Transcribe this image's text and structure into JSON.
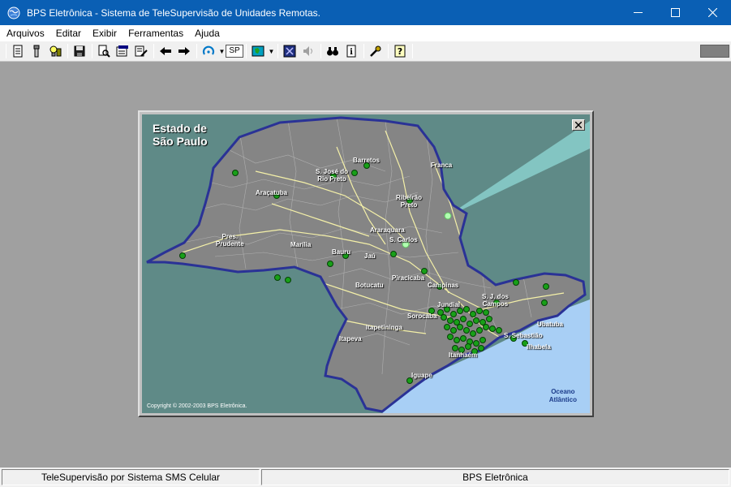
{
  "window": {
    "title": "BPS Eletrônica - Sistema de TeleSupervisão de Unidades Remotas."
  },
  "menu": [
    {
      "label": "Arquivos"
    },
    {
      "label": "Editar"
    },
    {
      "label": "Exibir"
    },
    {
      "label": "Ferramentas"
    },
    {
      "label": "Ajuda"
    }
  ],
  "toolbar": {
    "sp_label": "SP"
  },
  "map": {
    "title": "Estado de\nSão Paulo",
    "copyright": "Copyright © 2002-2003 BPS Eletrônica.",
    "ocean": "Oceano\nAtlântico",
    "colors": {
      "land": "#858585",
      "water": "#5f8a87",
      "sea": "#a8cff5",
      "border": "#2a3296",
      "roads": "#f4f0a8",
      "station": "#18a018"
    },
    "cities": [
      {
        "name": "Barretos"
      },
      {
        "name": "Franca"
      },
      {
        "name": "S. José do\nRio Preto"
      },
      {
        "name": "Araçatuba"
      },
      {
        "name": "Ribeirão\nPreto"
      },
      {
        "name": "Araraquara"
      },
      {
        "name": "S. Carlos"
      },
      {
        "name": "Pres.\nPrudente"
      },
      {
        "name": "Marília"
      },
      {
        "name": "Bauru"
      },
      {
        "name": "Jaú"
      },
      {
        "name": "Piracicaba"
      },
      {
        "name": "Campinas"
      },
      {
        "name": "Botucatu"
      },
      {
        "name": "Jundiaí"
      },
      {
        "name": "S. J. dos\nCampos"
      },
      {
        "name": "Sorocaba"
      },
      {
        "name": "Itapetininga"
      },
      {
        "name": "Itapeva"
      },
      {
        "name": "Ubatuba"
      },
      {
        "name": "S. Sebastião"
      },
      {
        "name": "Ilhabela"
      },
      {
        "name": "Itanhaém"
      },
      {
        "name": "Iguape"
      }
    ]
  },
  "status": {
    "left": "TeleSupervisão por Sistema SMS Celular",
    "right": "BPS Eletrônica"
  }
}
